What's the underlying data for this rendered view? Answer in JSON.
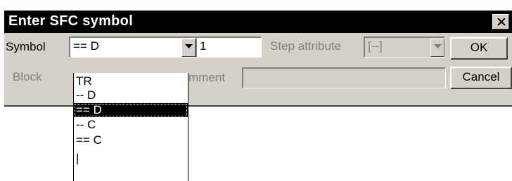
{
  "dialog": {
    "title": "Enter SFC symbol",
    "close_glyph": "✕",
    "symbol_label": "Symbol",
    "symbol_value": "== D",
    "number_value": "1",
    "step_attribute_label": "Step attribute",
    "step_attribute_value": "[--]",
    "block_label": "Block",
    "comment_label": "mment",
    "comment_value": "",
    "ok_label": "OK",
    "cancel_label": "Cancel"
  },
  "dropdown": {
    "items": [
      {
        "label": "TR",
        "selected": false
      },
      {
        "label": "-- D",
        "selected": false
      },
      {
        "label": "== D",
        "selected": true
      },
      {
        "label": "-- C",
        "selected": false
      },
      {
        "label": "== C",
        "selected": false
      },
      {
        "label": "|",
        "selected": false
      }
    ]
  },
  "icons": {
    "close": "close-icon",
    "dropdown_arrow": "chevron-down-icon"
  },
  "colors": {
    "titlebar": "#000000",
    "face": "#d4d0c8",
    "selection": "#000000",
    "disabled_text": "#808080"
  }
}
